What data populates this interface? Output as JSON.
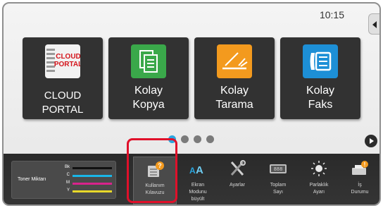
{
  "status": {
    "time": "10:15"
  },
  "tiles": [
    {
      "logo_line1": "CLOUD",
      "logo_line2": "PORTAL",
      "label": "CLOUD PORTAL"
    },
    {
      "label": "Kolay\nKopya"
    },
    {
      "label": "Kolay\nTarama"
    },
    {
      "label": "Kolay\nFaks"
    }
  ],
  "pager": {
    "pages": 4,
    "active_index": 0
  },
  "toner": {
    "title": "Toner Miktarı",
    "rows": [
      {
        "label": "Bk",
        "color": "#111111"
      },
      {
        "label": "C",
        "color": "#19b6e8"
      },
      {
        "label": "M",
        "color": "#d8238c"
      },
      {
        "label": "Y",
        "color": "#e8d82a"
      }
    ]
  },
  "functions": [
    {
      "label": "Kullanım\nKılavuzu",
      "icon": "user-guide-icon"
    },
    {
      "label": "Ekran\nModunu\nbüyült",
      "icon": "enlarge-display-icon"
    },
    {
      "label": "Ayarlar",
      "icon": "settings-tools-icon"
    },
    {
      "label": "Toplam\nSayı",
      "icon": "total-count-icon"
    },
    {
      "label": "Parlaklık\nAyarı",
      "icon": "brightness-icon"
    },
    {
      "label": "İş\nDurumu",
      "icon": "job-status-icon"
    }
  ],
  "colors": {
    "accent": "#2aa6e0",
    "highlight": "#e0102a",
    "tile_bg": "#323232",
    "orange": "#f39a1e",
    "green": "#3aa84a",
    "blue": "#1d8fd6",
    "cloud_red": "#d4151c"
  }
}
